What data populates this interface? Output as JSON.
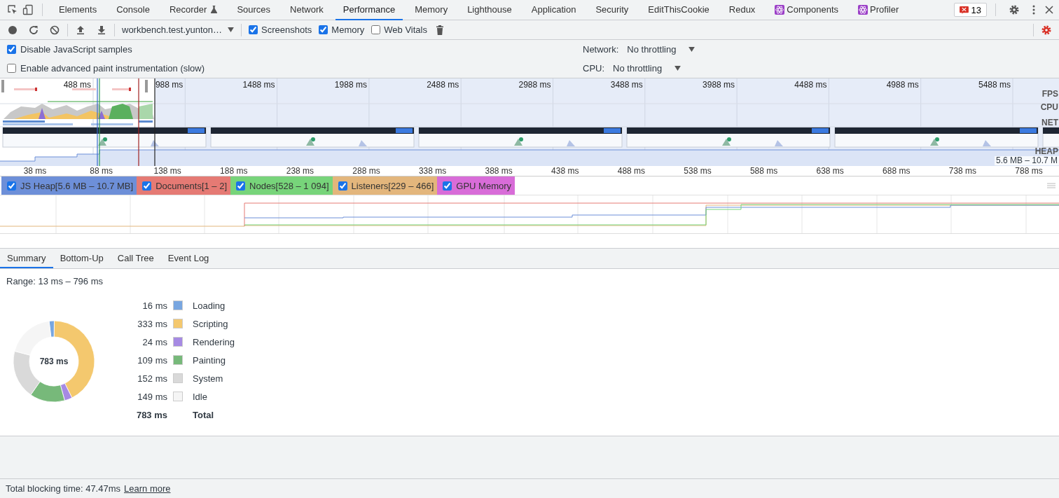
{
  "tabs": [
    {
      "label": "Elements",
      "selected": false,
      "kind": "plain"
    },
    {
      "label": "Console",
      "selected": false,
      "kind": "plain"
    },
    {
      "label": "Recorder",
      "selected": false,
      "kind": "flask"
    },
    {
      "label": "Sources",
      "selected": false,
      "kind": "plain"
    },
    {
      "label": "Network",
      "selected": false,
      "kind": "plain"
    },
    {
      "label": "Performance",
      "selected": true,
      "kind": "plain"
    },
    {
      "label": "Memory",
      "selected": false,
      "kind": "plain"
    },
    {
      "label": "Lighthouse",
      "selected": false,
      "kind": "plain"
    },
    {
      "label": "Application",
      "selected": false,
      "kind": "plain"
    },
    {
      "label": "Security",
      "selected": false,
      "kind": "plain"
    },
    {
      "label": "EditThisCookie",
      "selected": false,
      "kind": "plain"
    },
    {
      "label": "Redux",
      "selected": false,
      "kind": "plain"
    },
    {
      "label": "Components",
      "selected": false,
      "kind": "react"
    },
    {
      "label": "Profiler",
      "selected": false,
      "kind": "react"
    }
  ],
  "issues_badge": "13",
  "toolbar": {
    "profile_select": "workbench.test.yunton…",
    "options": [
      {
        "label": "Screenshots",
        "checked": true
      },
      {
        "label": "Memory",
        "checked": true
      },
      {
        "label": "Web Vitals",
        "checked": false
      }
    ]
  },
  "settings": {
    "options": [
      {
        "label": "Disable JavaScript samples",
        "checked": true
      },
      {
        "label": "Enable advanced paint instrumentation (slow)",
        "checked": false
      }
    ],
    "throttling": [
      {
        "label": "Network:",
        "value": "No throttling"
      },
      {
        "label": "CPU:",
        "value": "No throttling"
      }
    ]
  },
  "overview": {
    "time_ticks": [
      "488 ms",
      "988 ms",
      "1488 ms",
      "1988 ms",
      "2488 ms",
      "2988 ms",
      "3488 ms",
      "3988 ms",
      "4488 ms",
      "4988 ms",
      "5488 ms"
    ],
    "tracks": [
      "FPS",
      "CPU",
      "NET",
      "HEAP"
    ],
    "heap_range": "5.6 MB – 10.7 M",
    "ruler_ticks": [
      "38 ms",
      "88 ms",
      "138 ms",
      "188 ms",
      "238 ms",
      "288 ms",
      "338 ms",
      "388 ms",
      "438 ms",
      "488 ms",
      "538 ms",
      "588 ms",
      "638 ms",
      "688 ms",
      "738 ms",
      "788 ms"
    ]
  },
  "counters": [
    {
      "label": "JS Heap[5.6 MB – 10.7 MB]",
      "checked": true,
      "color": "#6d8fd8"
    },
    {
      "label": "Documents[1 – 2]",
      "checked": true,
      "color": "#e57a74"
    },
    {
      "label": "Nodes[528 – 1 094]",
      "checked": true,
      "color": "#77d47a"
    },
    {
      "label": "Listeners[229 – 466]",
      "checked": true,
      "color": "#e3b67c"
    },
    {
      "label": "GPU Memory",
      "checked": true,
      "color": "#d86cd8"
    }
  ],
  "details_tabs": [
    {
      "label": "Summary",
      "selected": true
    },
    {
      "label": "Bottom-Up",
      "selected": false
    },
    {
      "label": "Call Tree",
      "selected": false
    },
    {
      "label": "Event Log",
      "selected": false
    }
  ],
  "summary": {
    "range": "Range: 13 ms – 796 ms",
    "center_label": "783 ms",
    "rows": [
      {
        "time": "16 ms",
        "label": "Loading",
        "color": "#78a6e0"
      },
      {
        "time": "333 ms",
        "label": "Scripting",
        "color": "#f4c86e"
      },
      {
        "time": "24 ms",
        "label": "Rendering",
        "color": "#a68ae3"
      },
      {
        "time": "109 ms",
        "label": "Painting",
        "color": "#77b97a"
      },
      {
        "time": "152 ms",
        "label": "System",
        "color": "#d9d9d9"
      },
      {
        "time": "149 ms",
        "label": "Idle",
        "color": "#f5f5f5"
      }
    ],
    "total": {
      "time": "783 ms",
      "label": "Total"
    }
  },
  "status_bar": {
    "text": "Total blocking time: 47.47ms",
    "link": "Learn more"
  }
}
